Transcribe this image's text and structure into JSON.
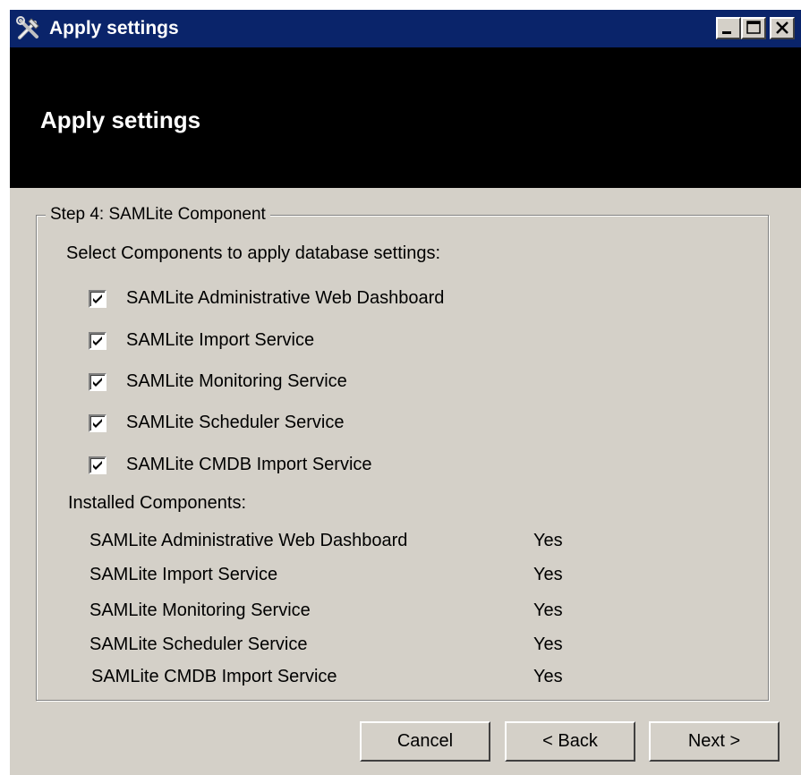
{
  "window": {
    "title": "Apply settings",
    "icon": "tools-icon",
    "controls": [
      "minimize-icon",
      "maximize-icon",
      "close-icon"
    ]
  },
  "banner": {
    "title": "Apply settings"
  },
  "group": {
    "legend": "Step 4: SAMLite Component",
    "select_prompt": "Select Components to apply database settings:",
    "components": [
      {
        "label": "SAMLite Administrative Web Dashboard",
        "checked": true
      },
      {
        "label": "SAMLite Import Service",
        "checked": true
      },
      {
        "label": "SAMLite Monitoring Service",
        "checked": true
      },
      {
        "label": "SAMLite Scheduler Service",
        "checked": true
      },
      {
        "label": "SAMLite CMDB Import Service",
        "checked": true
      }
    ],
    "installed_heading": "Installed Components:",
    "installed": [
      {
        "name": "SAMLite Administrative Web Dashboard",
        "status": "Yes"
      },
      {
        "name": "SAMLite Import Service",
        "status": "Yes"
      },
      {
        "name": "SAMLite Monitoring Service",
        "status": "Yes"
      },
      {
        "name": "SAMLite Scheduler Service",
        "status": "Yes"
      },
      {
        "name": "SAMLite CMDB Import Service",
        "status": "Yes"
      }
    ]
  },
  "buttons": {
    "cancel": "Cancel",
    "back": "< Back",
    "next": "Next >"
  },
  "colors": {
    "titlebar": "#0a246a",
    "banner": "#000000",
    "dialog_face": "#d4d0c8"
  }
}
